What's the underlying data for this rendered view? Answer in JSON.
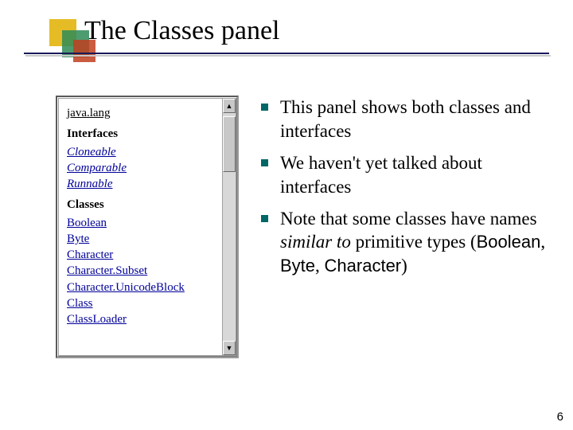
{
  "title": "The Classes panel",
  "panel": {
    "package": "java.lang",
    "interfaces_heading": "Interfaces",
    "interfaces": [
      "Cloneable",
      "Comparable",
      "Runnable"
    ],
    "classes_heading": "Classes",
    "classes": [
      "Boolean",
      "Byte",
      "Character",
      "Character.Subset",
      "Character.UnicodeBlock",
      "Class",
      "ClassLoader"
    ]
  },
  "scroll": {
    "up": "▲",
    "down": "▼"
  },
  "bullets": [
    {
      "text": "This panel shows both classes and interfaces"
    },
    {
      "text": "We haven't yet talked about interfaces"
    },
    {
      "parts": {
        "a": "Note that some classes have names ",
        "b": "similar to",
        "c": " primitive types (",
        "d": "Boolean",
        "e": ", ",
        "f": "Byte",
        "g": ", ",
        "h": "Character",
        "i": ")"
      }
    }
  ],
  "page": "6"
}
